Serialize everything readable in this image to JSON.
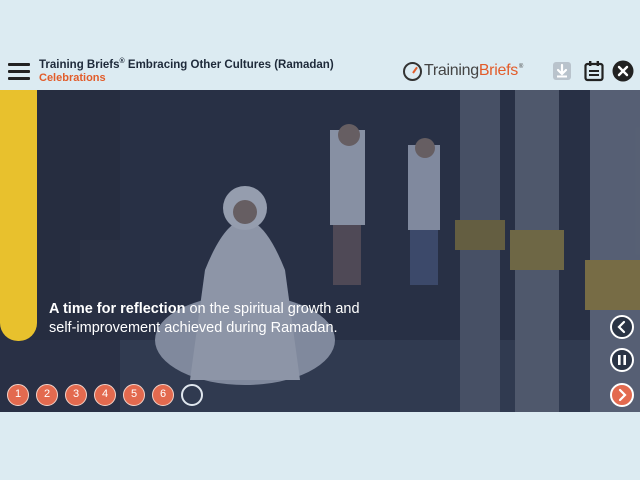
{
  "header": {
    "brand_prefix": "Training Briefs",
    "brand_reg": "®",
    "course_title": " Embracing Other Cultures (Ramadan)",
    "section": "Celebrations",
    "logo_text_a": "Training",
    "logo_text_b": "Briefs",
    "logo_reg": "®"
  },
  "slide": {
    "caption_bold": "A time for reflection",
    "caption_rest": " on the spiritual growth and self-improvement achieved during Ramadan."
  },
  "pager": {
    "pages": [
      "1",
      "2",
      "3",
      "4",
      "5",
      "6",
      ""
    ]
  },
  "icons": {
    "menu": "hamburger-menu-icon",
    "download": "download-icon",
    "notes": "notes-icon",
    "close": "close-icon",
    "prev": "chevron-left-icon",
    "pause": "pause-icon",
    "next": "chevron-right-icon"
  },
  "colors": {
    "accent": "#e25c2a",
    "yellow": "#e8c12d",
    "background": "#dcebf2",
    "pager": "#e36a4f"
  }
}
